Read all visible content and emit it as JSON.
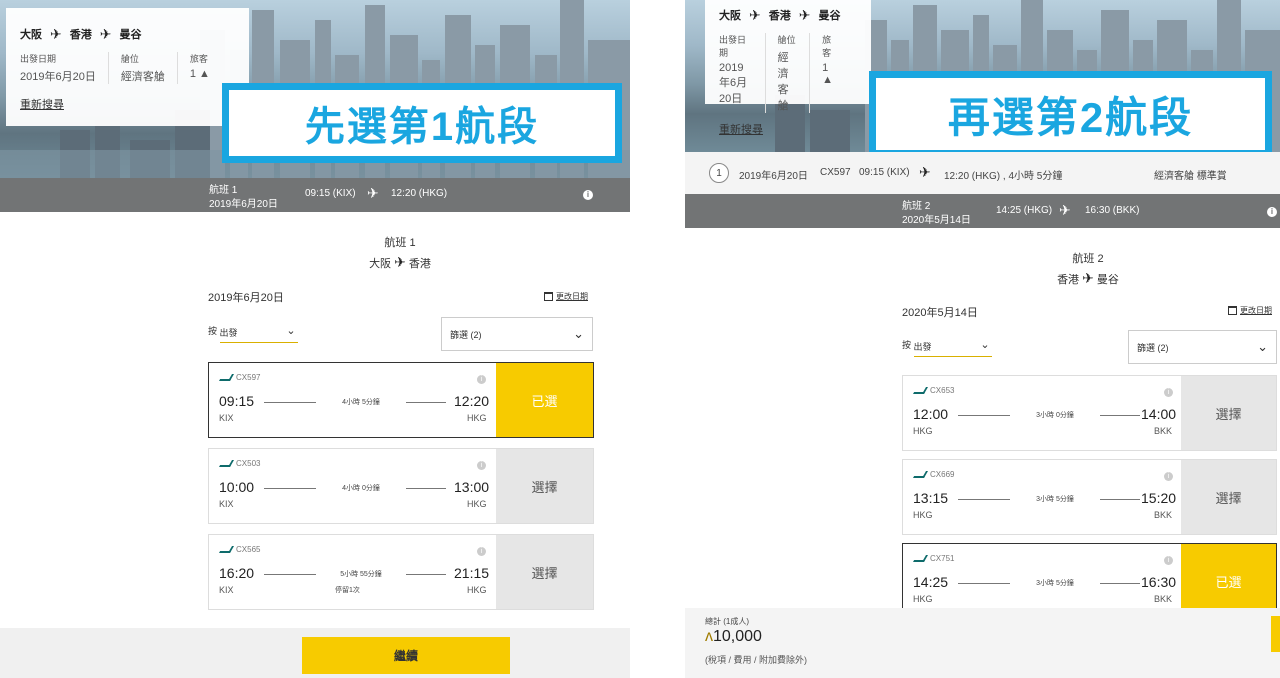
{
  "left": {
    "route": {
      "from": "大阪",
      "via": "香港",
      "to": "曼谷"
    },
    "meta": [
      {
        "label": "出發日期",
        "value": "2019年6月20日"
      },
      {
        "label": "艙位",
        "value": "經濟客艙"
      },
      {
        "label": "旅客",
        "value": "1"
      }
    ],
    "research": "重新搜尋",
    "banner": "先選第1航段",
    "flightbar": {
      "label": "航班 1",
      "date": "2019年6月20日",
      "dep": "09:15 (KIX)",
      "arr": "12:20 (HKG)"
    },
    "heading": {
      "title": "航班 1",
      "from": "大阪",
      "to": "香港"
    },
    "date": "2019年6月20日",
    "change_date": "更改日期",
    "sort": {
      "prefix": "按",
      "value": "出發"
    },
    "filter": "篩選 (2)",
    "flights": [
      {
        "no": "CX597",
        "dep": "09:15",
        "dep_ap": "KIX",
        "arr": "12:20",
        "arr_ap": "HKG",
        "dur": "4小時 5分鐘",
        "stop": "",
        "action": "已選",
        "selected": true
      },
      {
        "no": "CX503",
        "dep": "10:00",
        "dep_ap": "KIX",
        "arr": "13:00",
        "arr_ap": "HKG",
        "dur": "4小時 0分鐘",
        "stop": "",
        "action": "選擇",
        "selected": false
      },
      {
        "no": "CX565",
        "dep": "16:20",
        "dep_ap": "KIX",
        "arr": "21:15",
        "arr_ap": "HKG",
        "dur": "5小時 55分鐘",
        "stop": "停留1次",
        "action": "選擇",
        "selected": false
      }
    ],
    "continue": "繼續"
  },
  "right": {
    "route": {
      "from": "大阪",
      "via": "香港",
      "to": "曼谷"
    },
    "meta": [
      {
        "label": "出發日期",
        "value": "2019年6月20日"
      },
      {
        "label": "艙位",
        "value": "經濟客艙"
      },
      {
        "label": "旅客",
        "value": "1"
      }
    ],
    "research": "重新搜尋",
    "banner": "再選第2航段",
    "summary": {
      "num": "1",
      "date": "2019年6月20日",
      "no": "CX597",
      "dep": "09:15 (KIX)",
      "arr": "12:20 (HKG) , 4小時 5分鐘",
      "cabin": "經濟客艙 標準賞"
    },
    "flightbar": {
      "label": "航班 2",
      "date": "2020年5月14日",
      "dep": "14:25 (HKG)",
      "arr": "16:30 (BKK)"
    },
    "heading": {
      "title": "航班 2",
      "from": "香港",
      "to": "曼谷"
    },
    "date": "2020年5月14日",
    "change_date": "更改日期",
    "sort": {
      "prefix": "按",
      "value": "出發"
    },
    "filter": "篩選 (2)",
    "flights": [
      {
        "no": "CX653",
        "dep": "12:00",
        "dep_ap": "HKG",
        "arr": "14:00",
        "arr_ap": "BKK",
        "dur": "3小時 0分鐘",
        "stop": "",
        "action": "選擇",
        "selected": false
      },
      {
        "no": "CX669",
        "dep": "13:15",
        "dep_ap": "HKG",
        "arr": "15:20",
        "arr_ap": "BKK",
        "dur": "3小時 5分鐘",
        "stop": "",
        "action": "選擇",
        "selected": false
      },
      {
        "no": "CX751",
        "dep": "14:25",
        "dep_ap": "HKG",
        "arr": "16:30",
        "arr_ap": "BKK",
        "dur": "3小時 5分鐘",
        "stop": "",
        "action": "已選",
        "selected": true
      }
    ],
    "total": {
      "label": "總計 (1成人)",
      "value": "10,000",
      "note": "(稅項 / 費用 / 附加費除外)"
    }
  },
  "colors": {
    "accent": "#f7cb00",
    "banner": "#1aa6e0",
    "bar": "#727475"
  }
}
